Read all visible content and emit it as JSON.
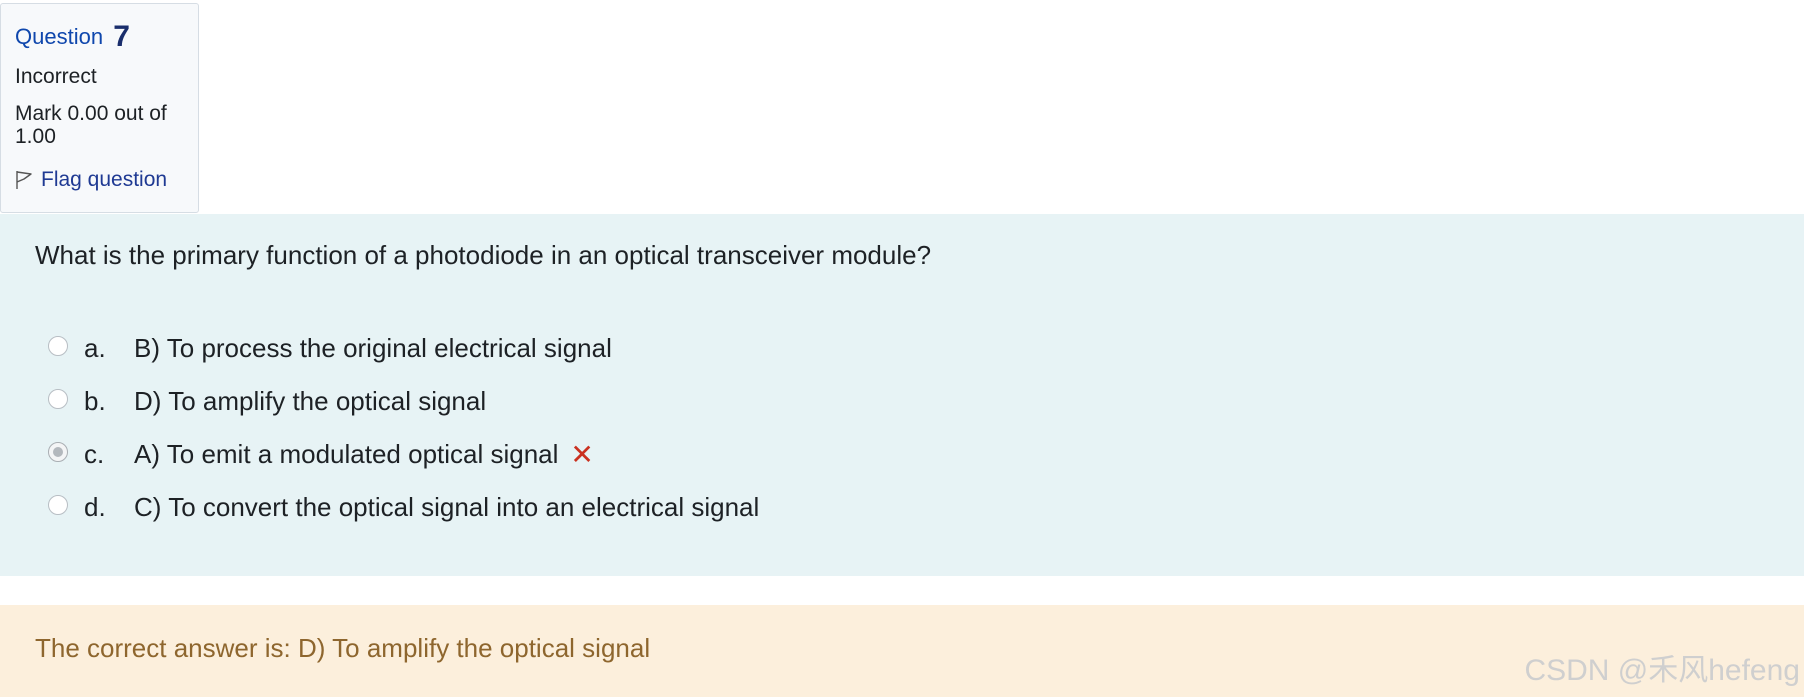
{
  "info": {
    "question_label": "Question",
    "question_number": "7",
    "state": "Incorrect",
    "grade": "Mark 0.00 out of 1.00",
    "flag_label": "Flag question"
  },
  "question": {
    "text": "What is the primary function of a photodiode in an optical transceiver module?",
    "answers": [
      {
        "letter": "a.",
        "text": "B) To process the original electrical signal",
        "selected": false
      },
      {
        "letter": "b.",
        "text": "D) To amplify the optical signal",
        "selected": false
      },
      {
        "letter": "c.",
        "text": "A) To emit a modulated optical signal",
        "selected": true,
        "mark": "✕"
      },
      {
        "letter": "d.",
        "text": "C) To convert the optical signal into an electrical signal",
        "selected": false
      }
    ]
  },
  "feedback": {
    "right_answer": "The correct answer is: D) To amplify the optical signal"
  },
  "watermark": "CSDN @禾风hefeng",
  "colors": {
    "info_bg": "#f7f9fb",
    "question_bg": "#e7f3f5",
    "feedback_bg": "#fcefdc",
    "feedback_text": "#8e662e",
    "incorrect_mark": "#ca3120"
  }
}
